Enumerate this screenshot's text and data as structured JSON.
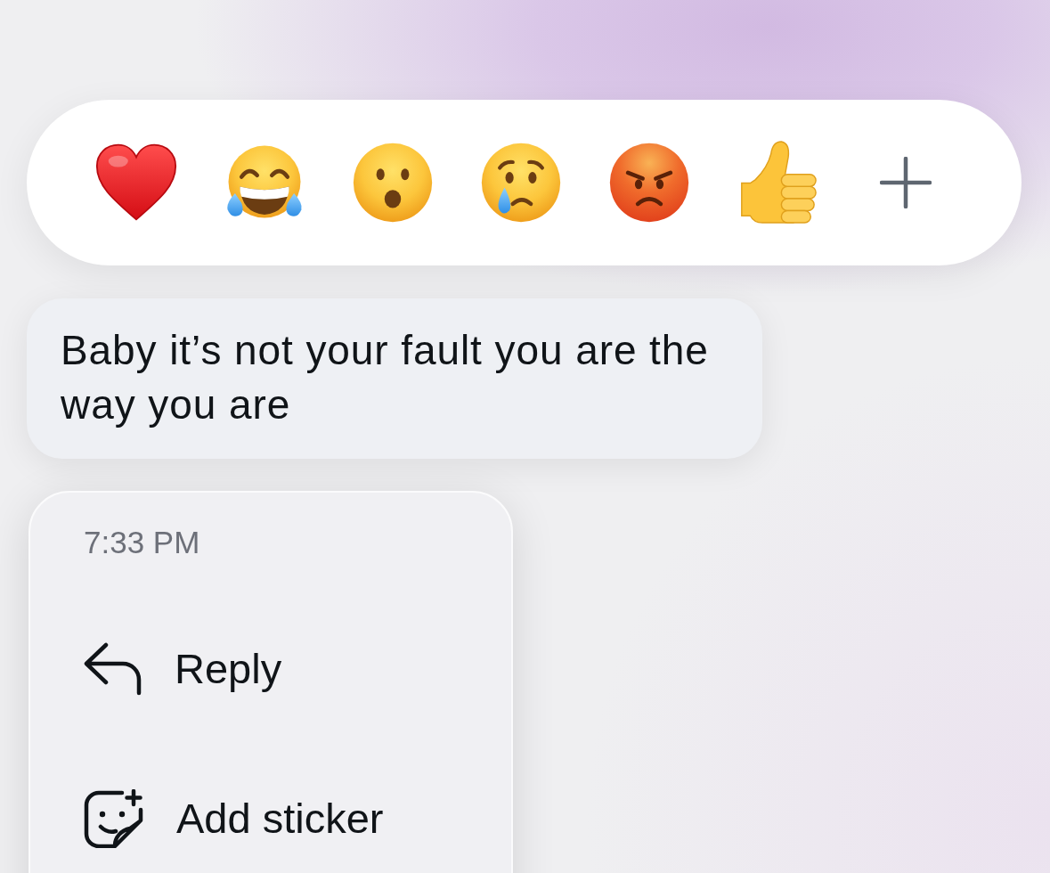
{
  "reaction_bar": {
    "reactions": [
      {
        "kind": "heart"
      },
      {
        "kind": "laughing"
      },
      {
        "kind": "surprised"
      },
      {
        "kind": "crying"
      },
      {
        "kind": "angry"
      },
      {
        "kind": "thumbs_up"
      },
      {
        "kind": "add"
      }
    ]
  },
  "message": {
    "text": "Baby it’s not your fault you are the way you are"
  },
  "context_menu": {
    "timestamp": "7:33 PM",
    "items": [
      {
        "kind": "reply",
        "label": "Reply"
      },
      {
        "kind": "sticker",
        "label": "Add sticker"
      }
    ]
  }
}
